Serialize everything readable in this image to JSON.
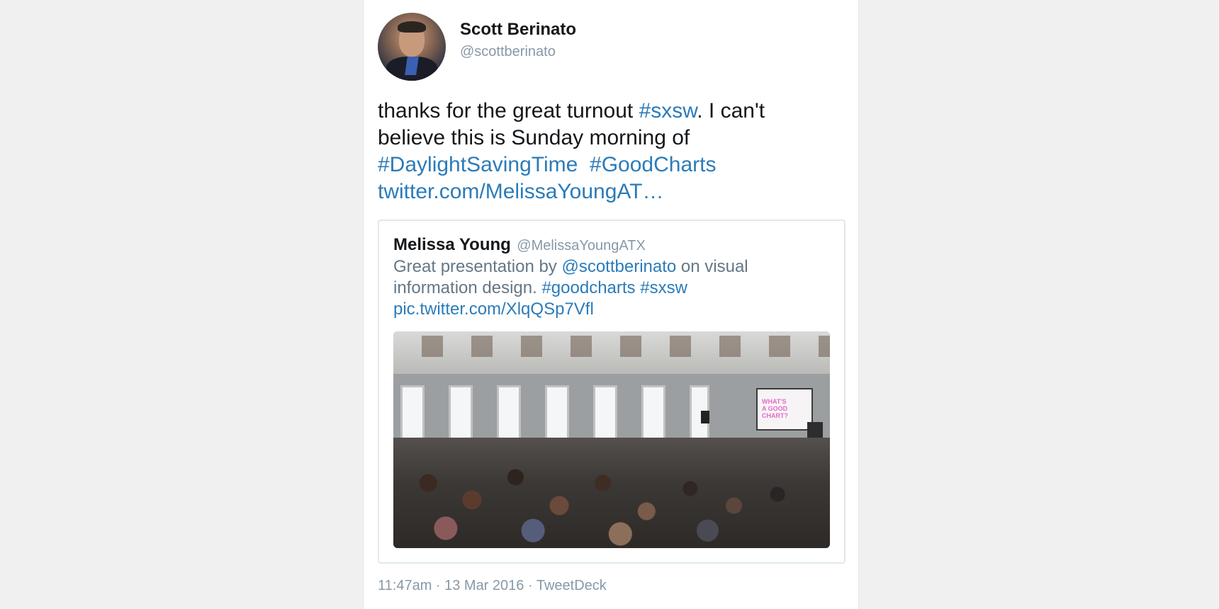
{
  "tweet": {
    "author": {
      "display_name": "Scott Berinato",
      "handle": "@scottberinato"
    },
    "text": {
      "part1": "thanks for the great turnout ",
      "hashtag1": "#sxsw",
      "part2": ". I can't believe this is Sunday morning of ",
      "hashtag2": "#DaylightSavingTime",
      "hashtag3": "#GoodCharts",
      "url": "twitter.com/MelissaYoungAT…"
    },
    "quoted": {
      "display_name": "Melissa Young",
      "handle": "@MelissaYoungATX",
      "text": {
        "part1": "Great presentation by ",
        "mention": "@scottberinato",
        "part2": " on visual information design. ",
        "hashtag1": "#goodcharts",
        "hashtag2": "#sxsw",
        "pic_link": "pic.twitter.com/XlqQSp7Vfl"
      },
      "photo": {
        "screen_text_line1": "WHAT'S",
        "screen_text_line2": "A GOOD",
        "screen_text_line3": "CHART?"
      }
    },
    "meta": "11:47am · 13 Mar 2016 · TweetDeck"
  },
  "colors": {
    "link": "#2b7bb9",
    "secondary_text": "#8899a6",
    "page_background": "#f0f0f0"
  }
}
